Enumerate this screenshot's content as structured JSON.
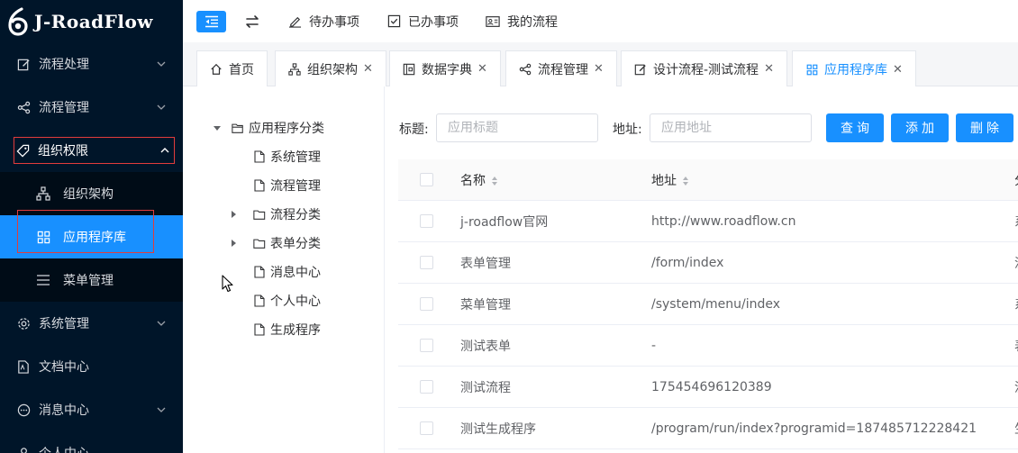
{
  "logo": {
    "text": "J-RoadFlow"
  },
  "sidebar": {
    "items": [
      {
        "label": "流程处理"
      },
      {
        "label": "流程管理"
      },
      {
        "label": "组织权限"
      },
      {
        "label": "系统管理"
      },
      {
        "label": "文档中心"
      },
      {
        "label": "消息中心"
      },
      {
        "label": "个人中心"
      }
    ],
    "sub_items": [
      {
        "label": "组织架构"
      },
      {
        "label": "应用程序库"
      },
      {
        "label": "菜单管理"
      }
    ]
  },
  "topbar": {
    "links": [
      {
        "label": "待办事项"
      },
      {
        "label": "已办事项"
      },
      {
        "label": "我的流程"
      }
    ]
  },
  "tabs": [
    {
      "label": "首页"
    },
    {
      "label": "组织架构"
    },
    {
      "label": "数据字典"
    },
    {
      "label": "流程管理"
    },
    {
      "label": "设计流程-测试流程"
    },
    {
      "label": "应用程序库"
    }
  ],
  "tree": {
    "root": "应用程序分类",
    "children": [
      {
        "label": "系统管理"
      },
      {
        "label": "流程管理"
      },
      {
        "label": "流程分类"
      },
      {
        "label": "表单分类"
      },
      {
        "label": "消息中心"
      },
      {
        "label": "个人中心"
      },
      {
        "label": "生成程序"
      }
    ]
  },
  "search": {
    "title_label": "标题:",
    "title_placeholder": "应用标题",
    "url_label": "地址:",
    "url_placeholder": "应用地址",
    "query_label": "查询",
    "add_label": "添加",
    "delete_label": "删除"
  },
  "table": {
    "headers": {
      "name": "名称",
      "url": "地址",
      "more": "分"
    },
    "rows": [
      {
        "name": "j-roadflow官网",
        "url": "http://www.roadflow.cn",
        "more": "系"
      },
      {
        "name": "表单管理",
        "url": "/form/index",
        "more": "流"
      },
      {
        "name": "菜单管理",
        "url": "/system/menu/index",
        "more": "系"
      },
      {
        "name": "测试表单",
        "url": "-",
        "more": "表"
      },
      {
        "name": "测试流程",
        "url": "175454696120389",
        "more": "流"
      },
      {
        "name": "测试生成程序",
        "url": "/program/run/index?programid=187485712228421",
        "more": "生"
      }
    ]
  },
  "colors": {
    "primary": "#1890ff",
    "sidebar_bg": "#001529",
    "highlight_border": "#e23c3c"
  }
}
